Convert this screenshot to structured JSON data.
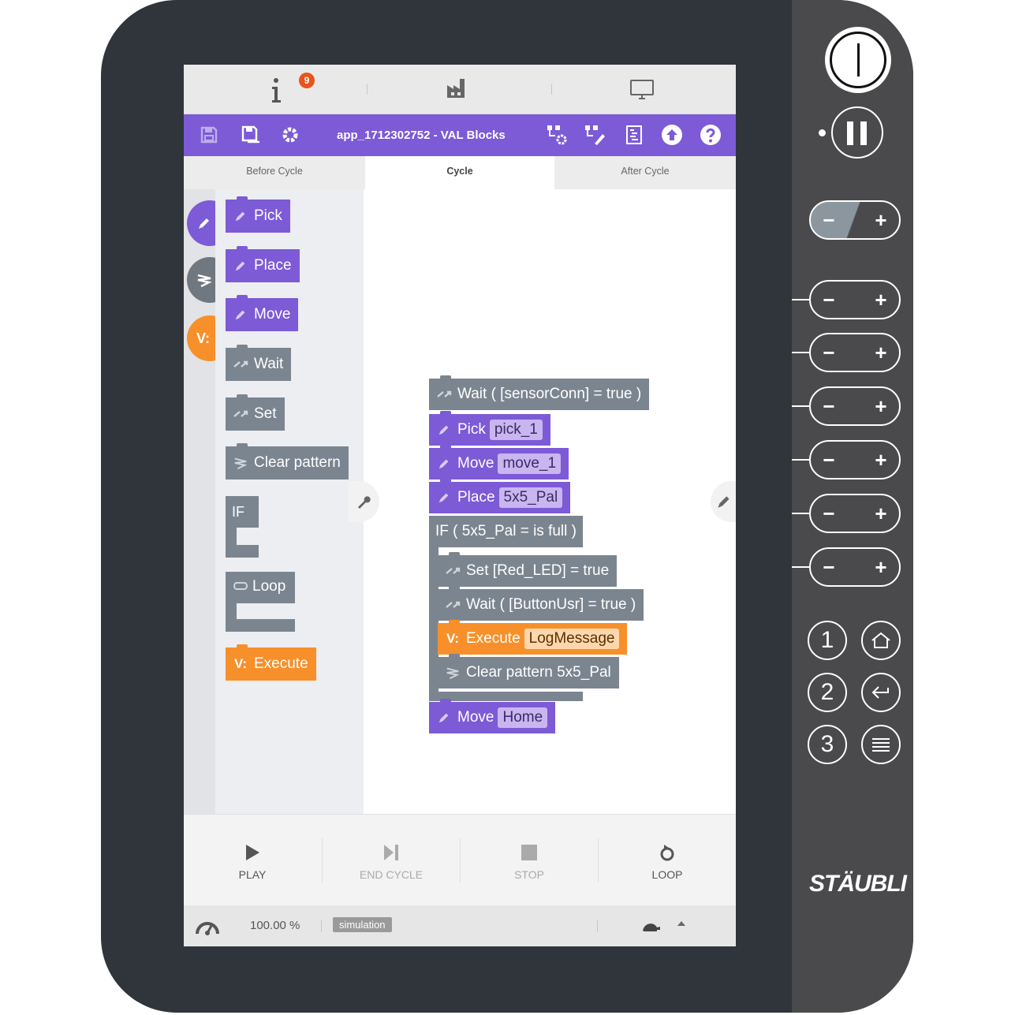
{
  "topbar": {
    "info_badge": "9"
  },
  "app": {
    "title": "app_1712302752 - VAL Blocks"
  },
  "tabs": [
    {
      "label": "Before Cycle",
      "active": false
    },
    {
      "label": "Cycle",
      "active": true
    },
    {
      "label": "After Cycle",
      "active": false
    }
  ],
  "categories": [
    {
      "icon": "pen-icon",
      "color": "#7d5ad6"
    },
    {
      "icon": "pattern-icon",
      "color": "#6f7780"
    },
    {
      "icon": "val-icon",
      "color": "#f7902a",
      "label": "V:"
    }
  ],
  "palette": {
    "pick": "Pick",
    "place": "Place",
    "move": "Move",
    "wait": "Wait",
    "set": "Set",
    "clear_pattern": "Clear pattern",
    "if": "IF",
    "loop": "Loop",
    "execute": "Execute"
  },
  "program": {
    "wait_sensor": "Wait ( [sensorConn] = true )",
    "pick": {
      "label": "Pick",
      "value": "pick_1"
    },
    "move1": {
      "label": "Move",
      "value": "move_1"
    },
    "place": {
      "label": "Place",
      "value": "5x5_Pal"
    },
    "if": "IF ( 5x5_Pal = is full )",
    "set_led": "Set [Red_LED] = true",
    "wait_button": "Wait ( [ButtonUsr] = true )",
    "execute": {
      "label": "Execute",
      "value": "LogMessage"
    },
    "clear": "Clear pattern 5x5_Pal",
    "move_home": {
      "label": "Move",
      "value": "Home"
    }
  },
  "controls": {
    "play": "PLAY",
    "end_cycle": "END CYCLE",
    "stop": "STOP",
    "loop": "LOOP"
  },
  "status": {
    "speed": "100.00 %",
    "mode": "simulation"
  },
  "device": {
    "brand": "STÄUBLI",
    "keys": [
      "1",
      "2",
      "3"
    ],
    "minus": "−",
    "plus": "+"
  },
  "colors": {
    "accent": "#7d5ad6",
    "motion_block": "#7d5ad6",
    "io_block": "#7b8590",
    "val_block": "#f7902a",
    "badge": "#e8541c"
  }
}
